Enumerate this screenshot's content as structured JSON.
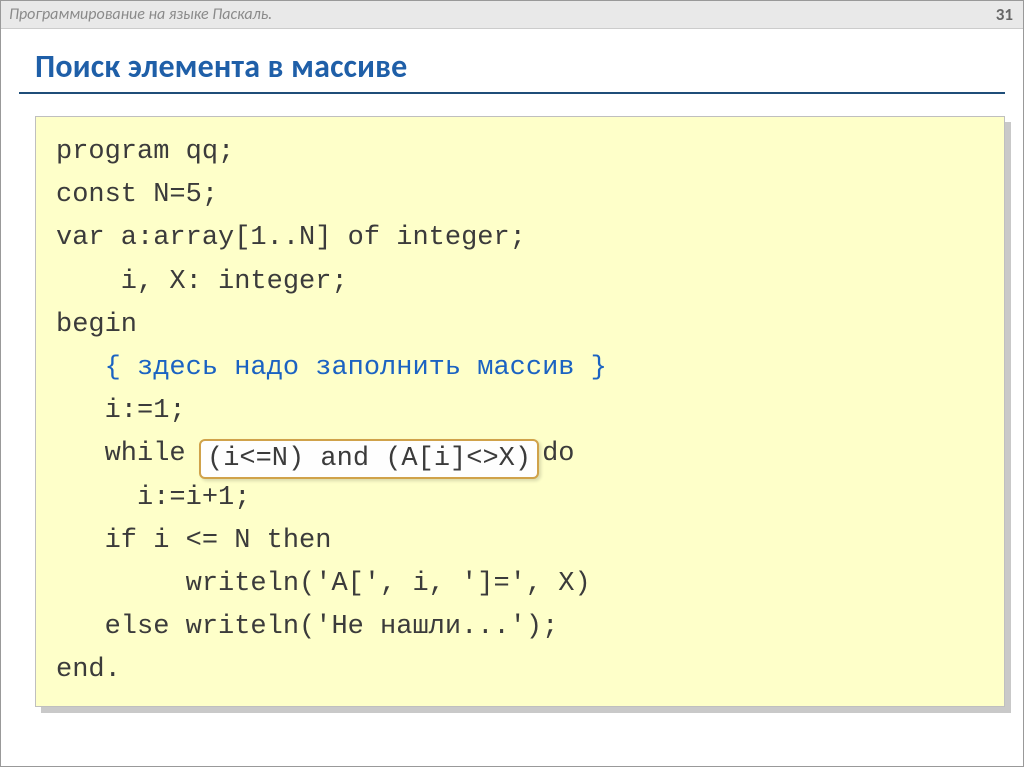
{
  "header": {
    "breadcrumb": "Программирование на языке Паскаль.",
    "page_number": "31"
  },
  "title": "Поиск элемента в массиве",
  "code": {
    "line1": "program qq;",
    "line2": "const N=5;",
    "line3": "var a:array[1..N] of integer;",
    "line4": "    i, X: integer;",
    "line5": "begin",
    "line6_comment": "   { здесь надо заполнить массив }",
    "line7": "   i:=1;",
    "line8a": "   while ",
    "line8b_highlight": "(i<=N) and (A[i]<>X)",
    "line8c": " do",
    "line9": "     i:=i+1;",
    "line10": "   if i <= N then",
    "line11": "        writeln('A[', i, ']=', X)",
    "line12": "   else writeln('Не нашли...');",
    "line13": "end."
  }
}
